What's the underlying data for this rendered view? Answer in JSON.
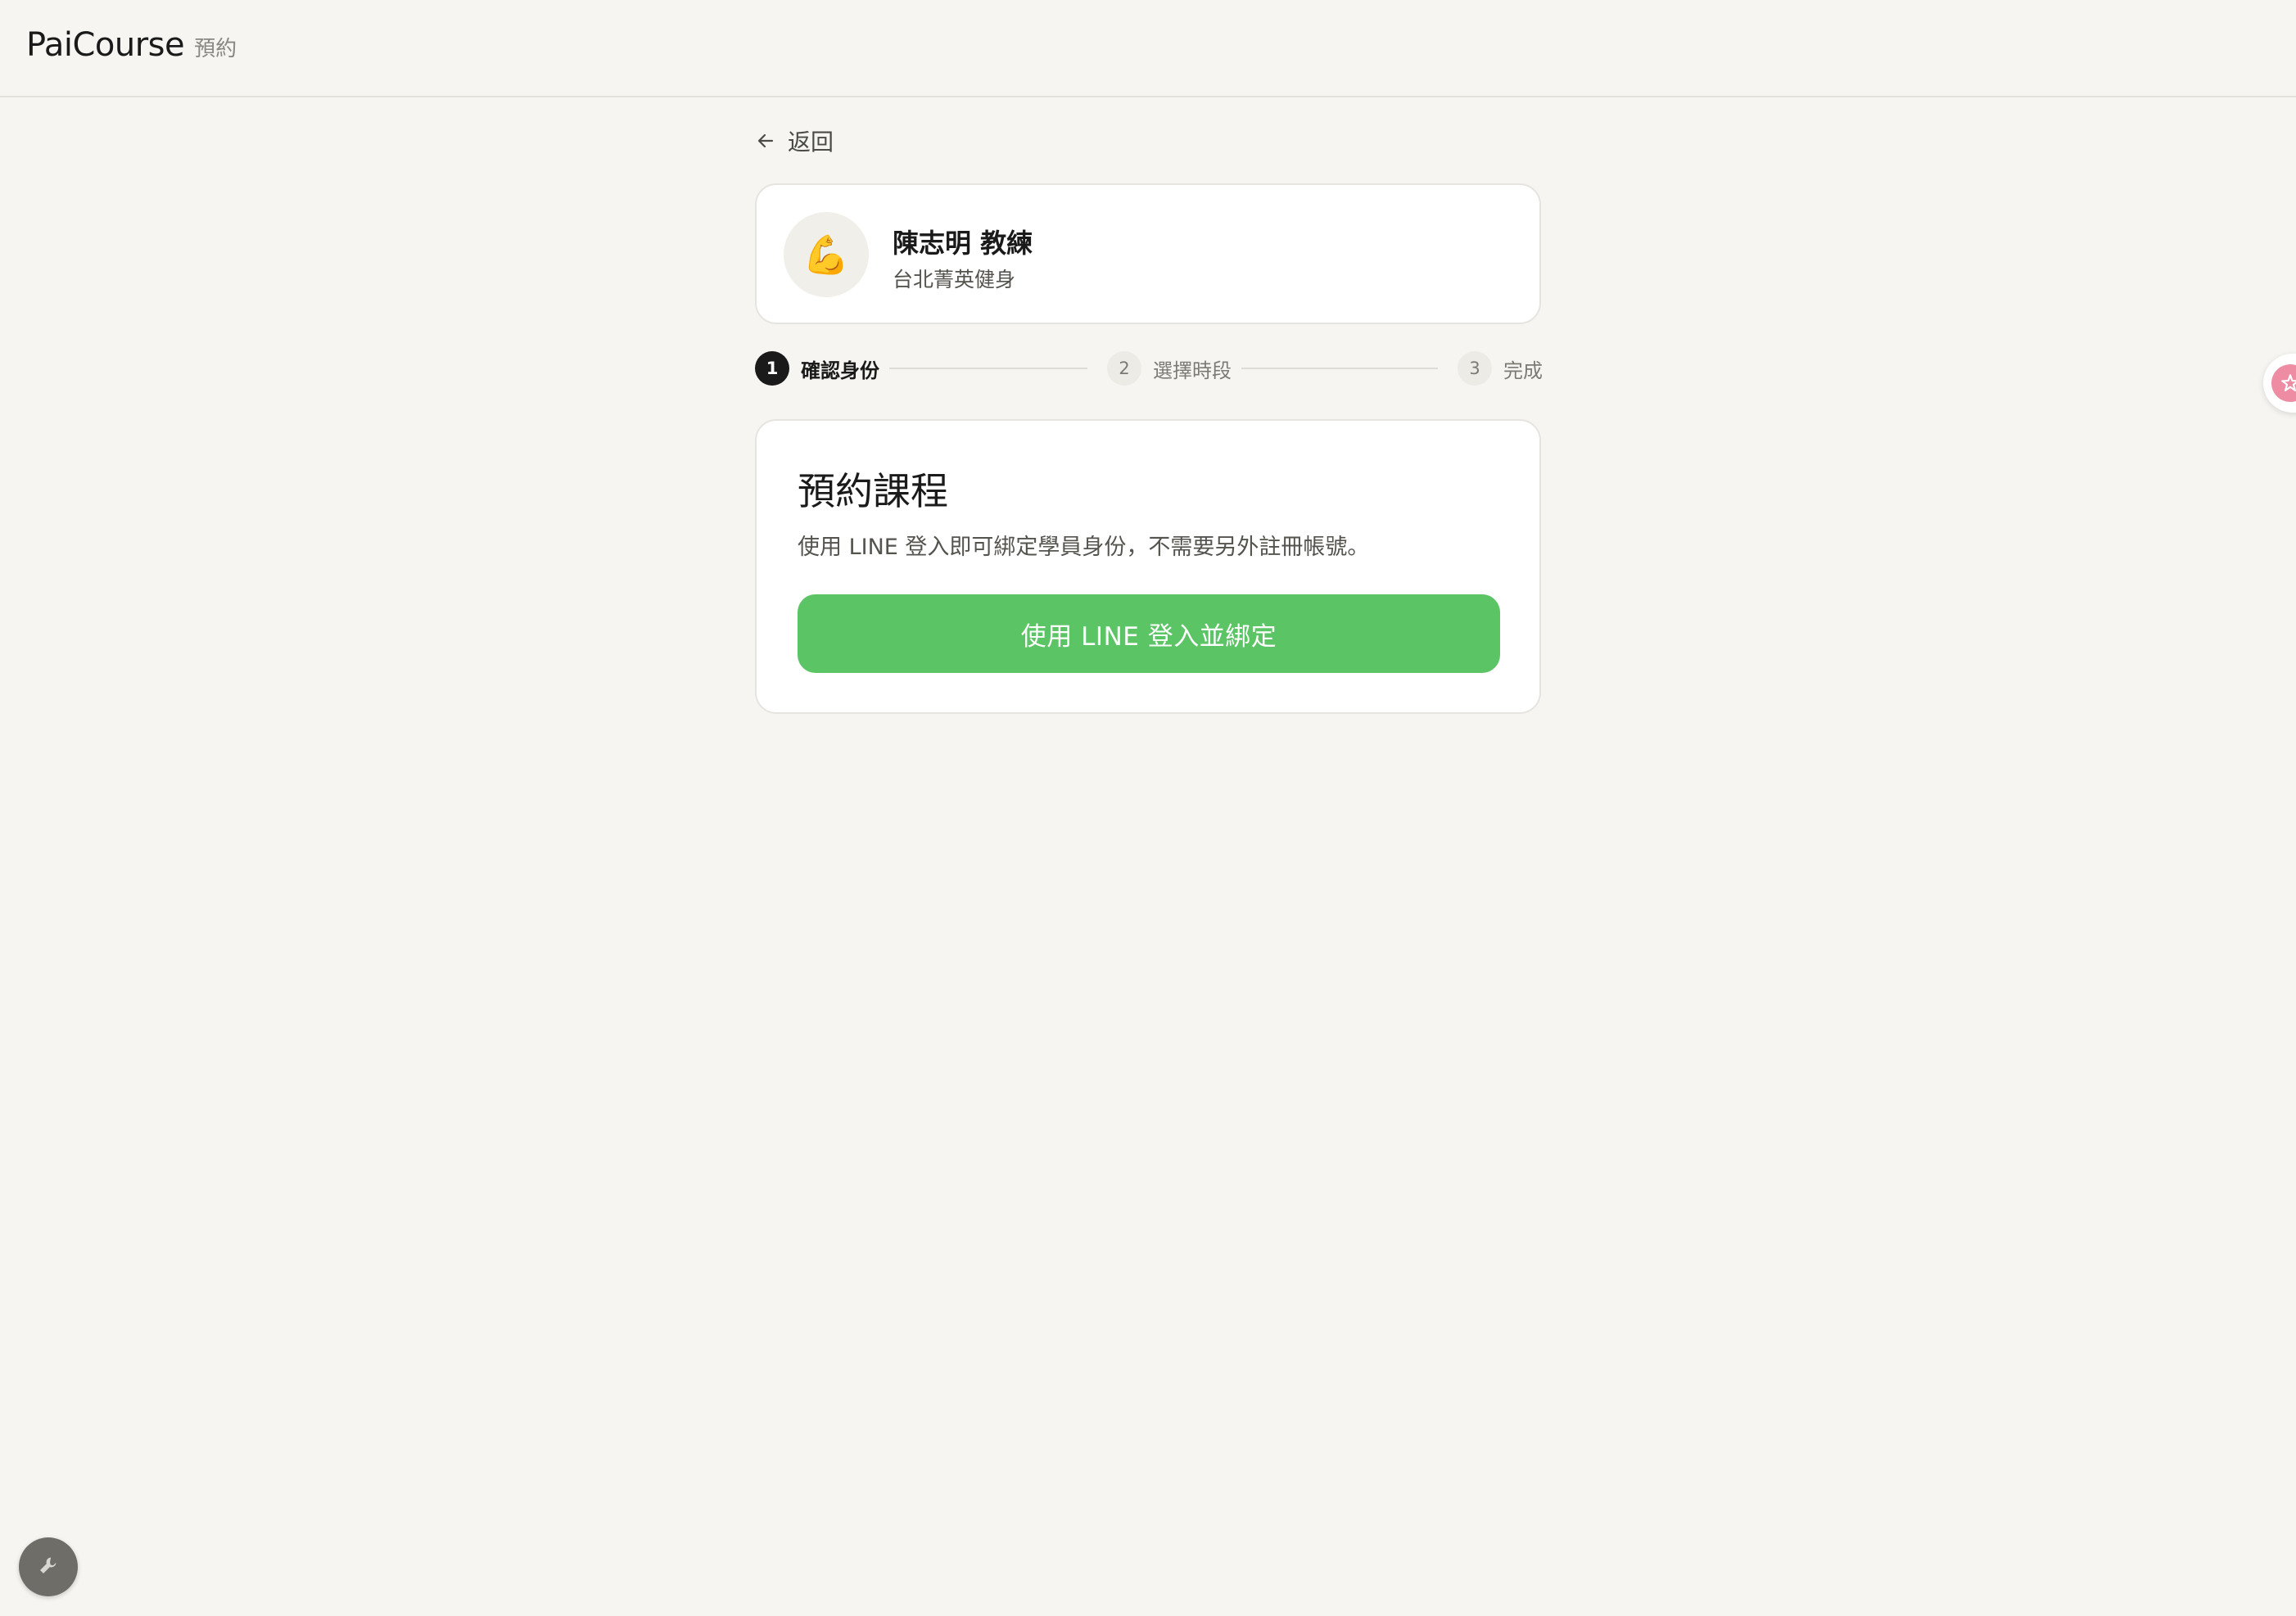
{
  "header": {
    "brand": "PaiCourse",
    "subtitle": "預約"
  },
  "nav": {
    "back_label": "返回"
  },
  "coach": {
    "avatar_emoji": "💪",
    "name": "陳志明 教練",
    "gym": "台北菁英健身"
  },
  "stepper": {
    "steps": [
      {
        "number": "1",
        "label": "確認身份",
        "state": "active"
      },
      {
        "number": "2",
        "label": "選擇時段",
        "state": "inactive"
      },
      {
        "number": "3",
        "label": "完成",
        "state": "inactive"
      }
    ]
  },
  "booking": {
    "title": "預約課程",
    "description": "使用 LINE 登入即可綁定學員身份，不需要另外註冊帳號。",
    "button_label": "使用 LINE 登入並綁定"
  },
  "colors": {
    "background": "#f6f5f1",
    "line_green": "#5bc565",
    "step_active": "#1a1a1a",
    "widget_pink": "#ee8ca4"
  },
  "icons": {
    "back": "arrow-left-icon",
    "tool": "wrench-icon",
    "widget": "sparkle-icon"
  }
}
